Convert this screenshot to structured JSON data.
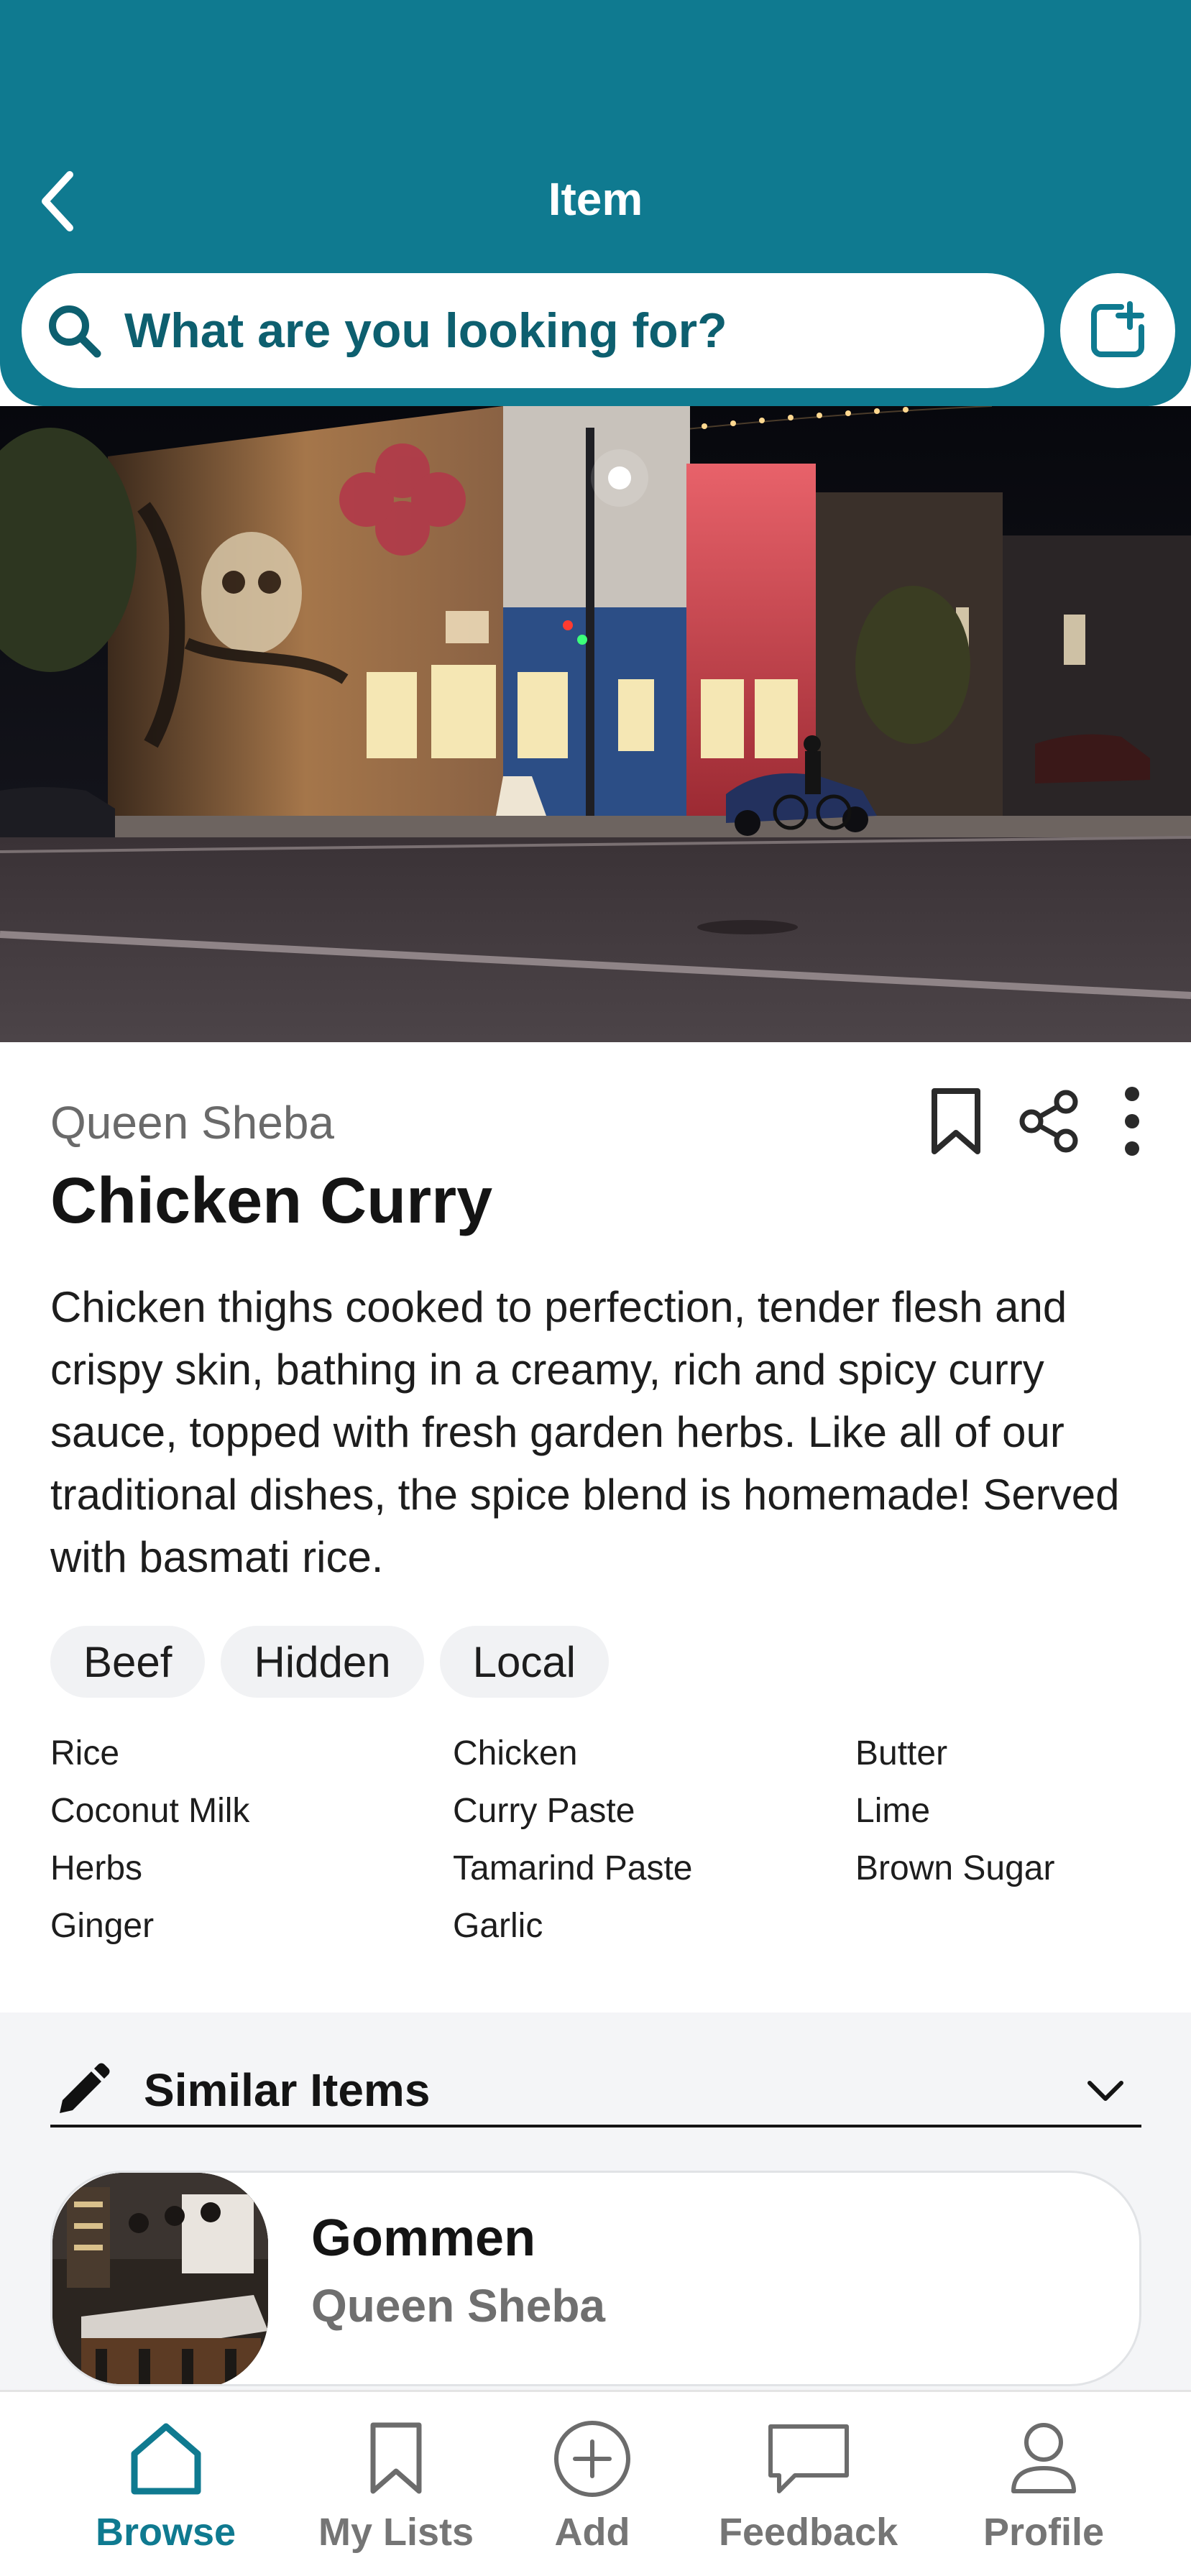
{
  "header": {
    "title": "Item",
    "search_placeholder": "What are you looking for?",
    "accent_color": "#0f7a90"
  },
  "item": {
    "restaurant": "Queen Sheba",
    "name": "Chicken Curry",
    "description": "Chicken thighs cooked to perfection, tender flesh and crispy skin, bathing in a creamy, rich and spicy curry sauce, topped with fresh garden herbs. Like all of our traditional dishes, the spice blend is homemade! Served with basmati rice.",
    "tags": [
      "Beef",
      "Hidden",
      "Local"
    ],
    "ingredients": [
      "Rice",
      "Chicken",
      "Butter",
      "Coconut Milk",
      "Curry Paste",
      "Lime",
      "Herbs",
      "Tamarind Paste",
      "Brown Sugar",
      "Ginger",
      "Garlic"
    ]
  },
  "similar": {
    "title": "Similar Items",
    "items": [
      {
        "name": "Gommen",
        "restaurant": "Queen Sheba"
      }
    ]
  },
  "nav": {
    "items": [
      {
        "label": "Browse",
        "icon": "home-icon",
        "active": true
      },
      {
        "label": "My Lists",
        "icon": "bookmark-icon",
        "active": false
      },
      {
        "label": "Add",
        "icon": "plus-circle-icon",
        "active": false
      },
      {
        "label": "Feedback",
        "icon": "chat-bubble-icon",
        "active": false
      },
      {
        "label": "Profile",
        "icon": "person-icon",
        "active": false
      }
    ]
  }
}
